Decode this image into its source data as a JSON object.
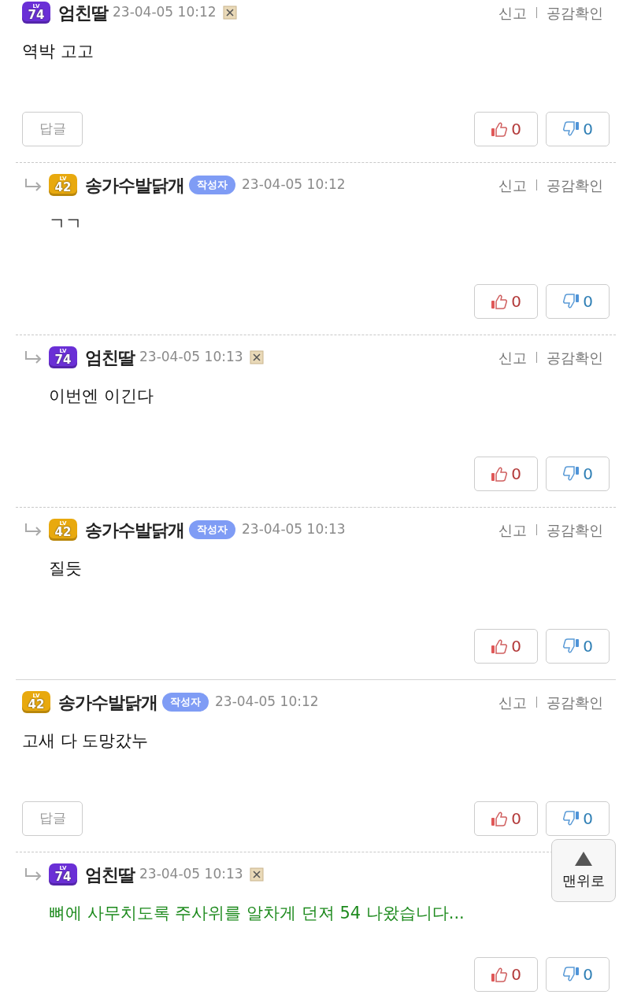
{
  "comments": [
    {
      "reply": false,
      "rank": {
        "tag": "LV",
        "number": "74",
        "color": "#6a2fd6"
      },
      "author": "엄친딸",
      "time": "23-04-05 10:12",
      "blocked_icon": true,
      "body": "역박 고고",
      "highlighted": false,
      "report": "신고",
      "empathy": "공감확인",
      "reply_button": "답글",
      "likes": "0",
      "dislikes": "0"
    },
    {
      "reply": true,
      "rank": {
        "tag": "LV",
        "number": "42",
        "color": "#e8a90e"
      },
      "author": "송가수발닭개",
      "writer_tag": "작성자",
      "time": "23-04-05 10:12",
      "blocked_icon": false,
      "body": "ㄱㄱ",
      "highlighted": false,
      "report": "신고",
      "empathy": "공감확인",
      "likes": "0",
      "dislikes": "0"
    },
    {
      "reply": true,
      "rank": {
        "tag": "LV",
        "number": "74",
        "color": "#6a2fd6"
      },
      "author": "엄친딸",
      "time": "23-04-05 10:13",
      "blocked_icon": true,
      "body": "이번엔 이긴다",
      "highlighted": false,
      "report": "신고",
      "empathy": "공감확인",
      "likes": "0",
      "dislikes": "0"
    },
    {
      "reply": true,
      "rank": {
        "tag": "LV",
        "number": "42",
        "color": "#e8a90e"
      },
      "author": "송가수발닭개",
      "writer_tag": "작성자",
      "time": "23-04-05 10:13",
      "blocked_icon": false,
      "body": "질듯",
      "highlighted": false,
      "report": "신고",
      "empathy": "공감확인",
      "likes": "0",
      "dislikes": "0"
    },
    {
      "reply": false,
      "rank": {
        "tag": "LV",
        "number": "42",
        "color": "#e8a90e"
      },
      "author": "송가수발닭개",
      "writer_tag": "작성자",
      "time": "23-04-05 10:12",
      "blocked_icon": false,
      "body": "고새 다 도망갔누",
      "highlighted": false,
      "report": "신고",
      "empathy": "공감확인",
      "reply_button": "답글",
      "likes": "0",
      "dislikes": "0"
    },
    {
      "reply": true,
      "rank": {
        "tag": "LV",
        "number": "74",
        "color": "#6a2fd6"
      },
      "author": "엄친딸",
      "time": "23-04-05 10:13",
      "blocked_icon": true,
      "body": "뼈에 사무치도록 주사위를 알차게 던져 54 나왔습니다...",
      "highlighted": true,
      "likes": "0",
      "dislikes": "0"
    }
  ],
  "top_button": {
    "label": "맨위로"
  }
}
